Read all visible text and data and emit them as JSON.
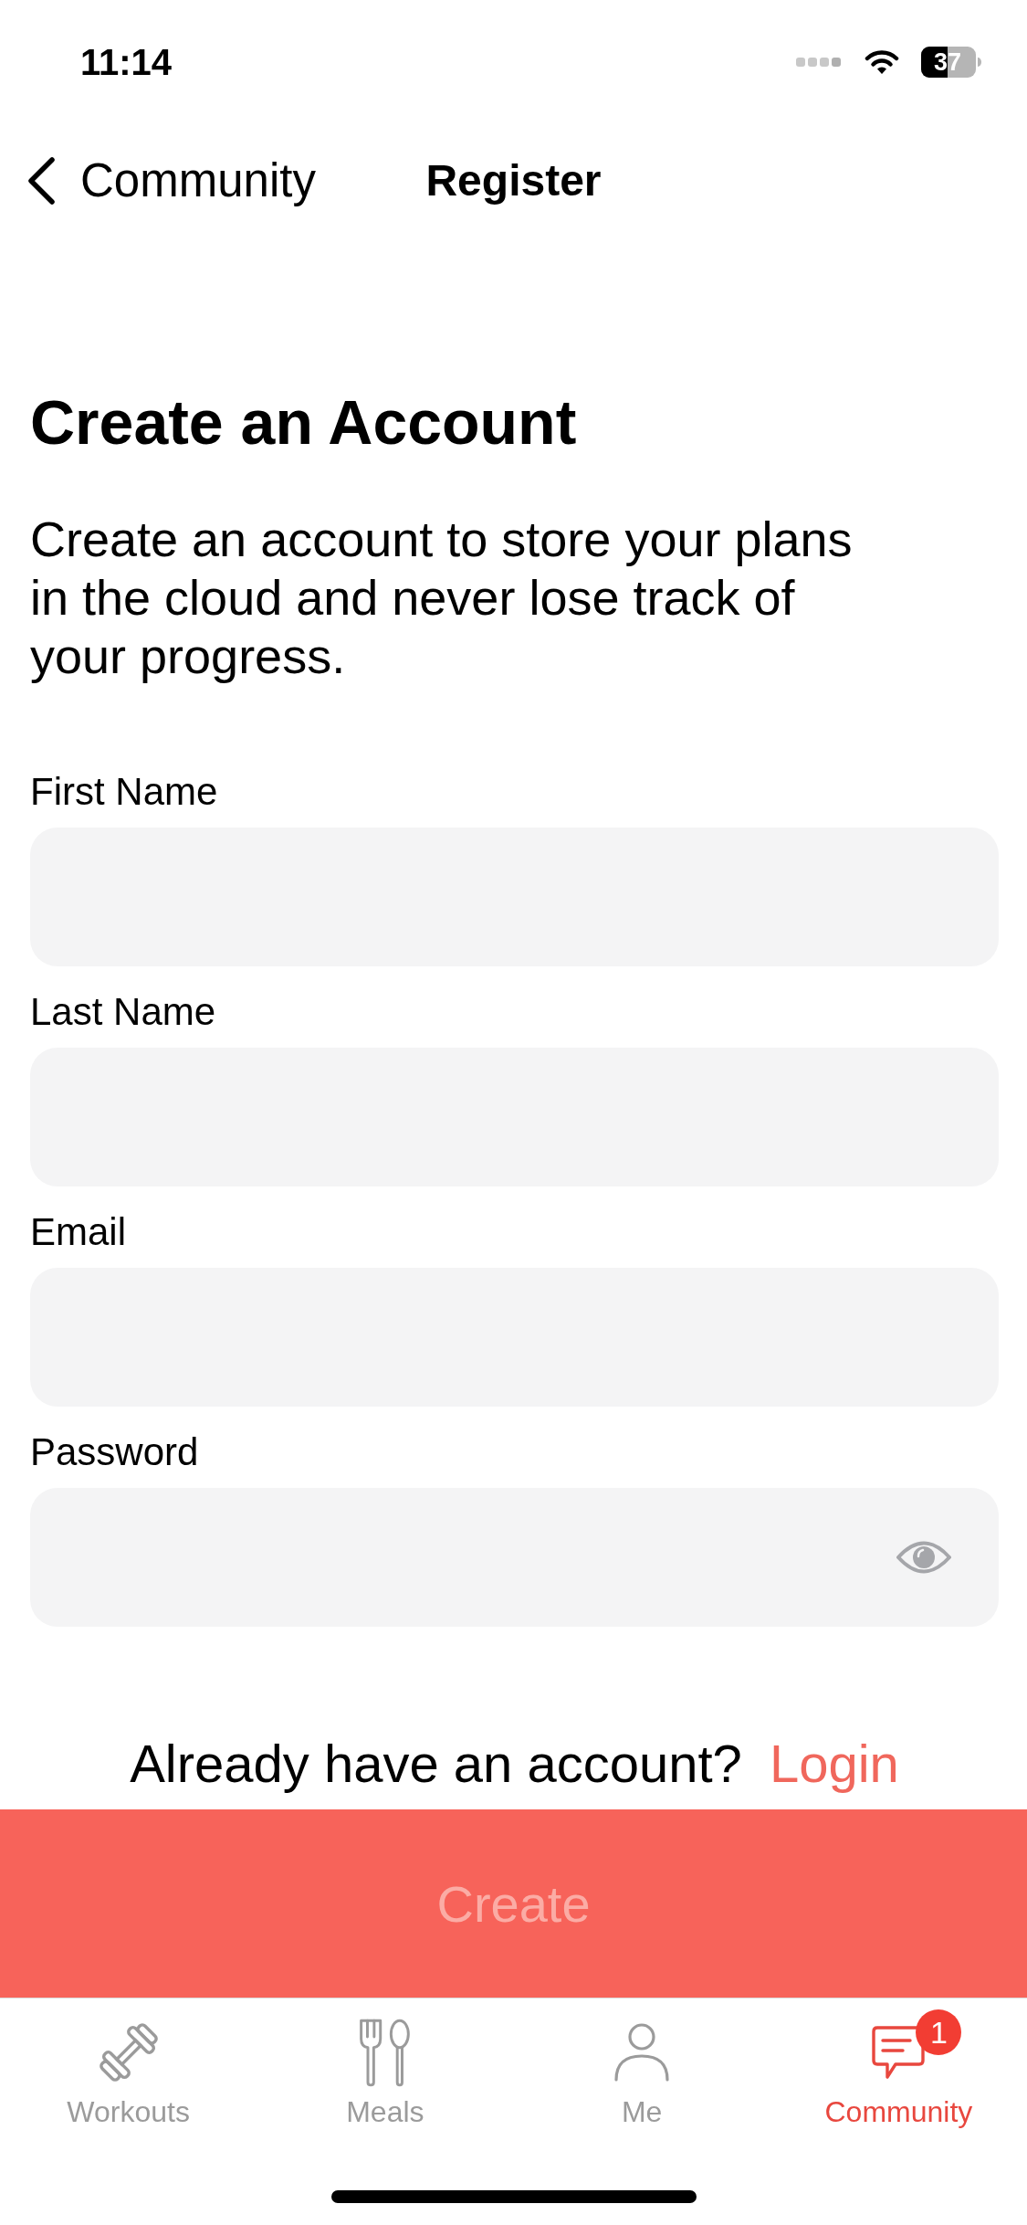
{
  "status_bar": {
    "time": "11:14",
    "battery": "37"
  },
  "nav_bar": {
    "back_label": "Community",
    "title": "Register"
  },
  "heading": "Create an Account",
  "intro": "Create an account to store your plans in the cloud and never lose track of your progress.",
  "form": {
    "fields": [
      {
        "label": "First Name",
        "kind": "text"
      },
      {
        "label": "Last Name",
        "kind": "text"
      },
      {
        "label": "Email",
        "kind": "text"
      },
      {
        "label": "Password",
        "kind": "password"
      }
    ]
  },
  "login_prompt": {
    "text": "Already have an account?",
    "link": "Login"
  },
  "create_button": {
    "label": "Create",
    "disabled": true
  },
  "tab_bar": {
    "tabs": [
      {
        "label": "Workouts",
        "selected": false
      },
      {
        "label": "Meals",
        "selected": false
      },
      {
        "label": "Me",
        "selected": false
      },
      {
        "label": "Community",
        "selected": true,
        "badge": "1"
      }
    ]
  }
}
